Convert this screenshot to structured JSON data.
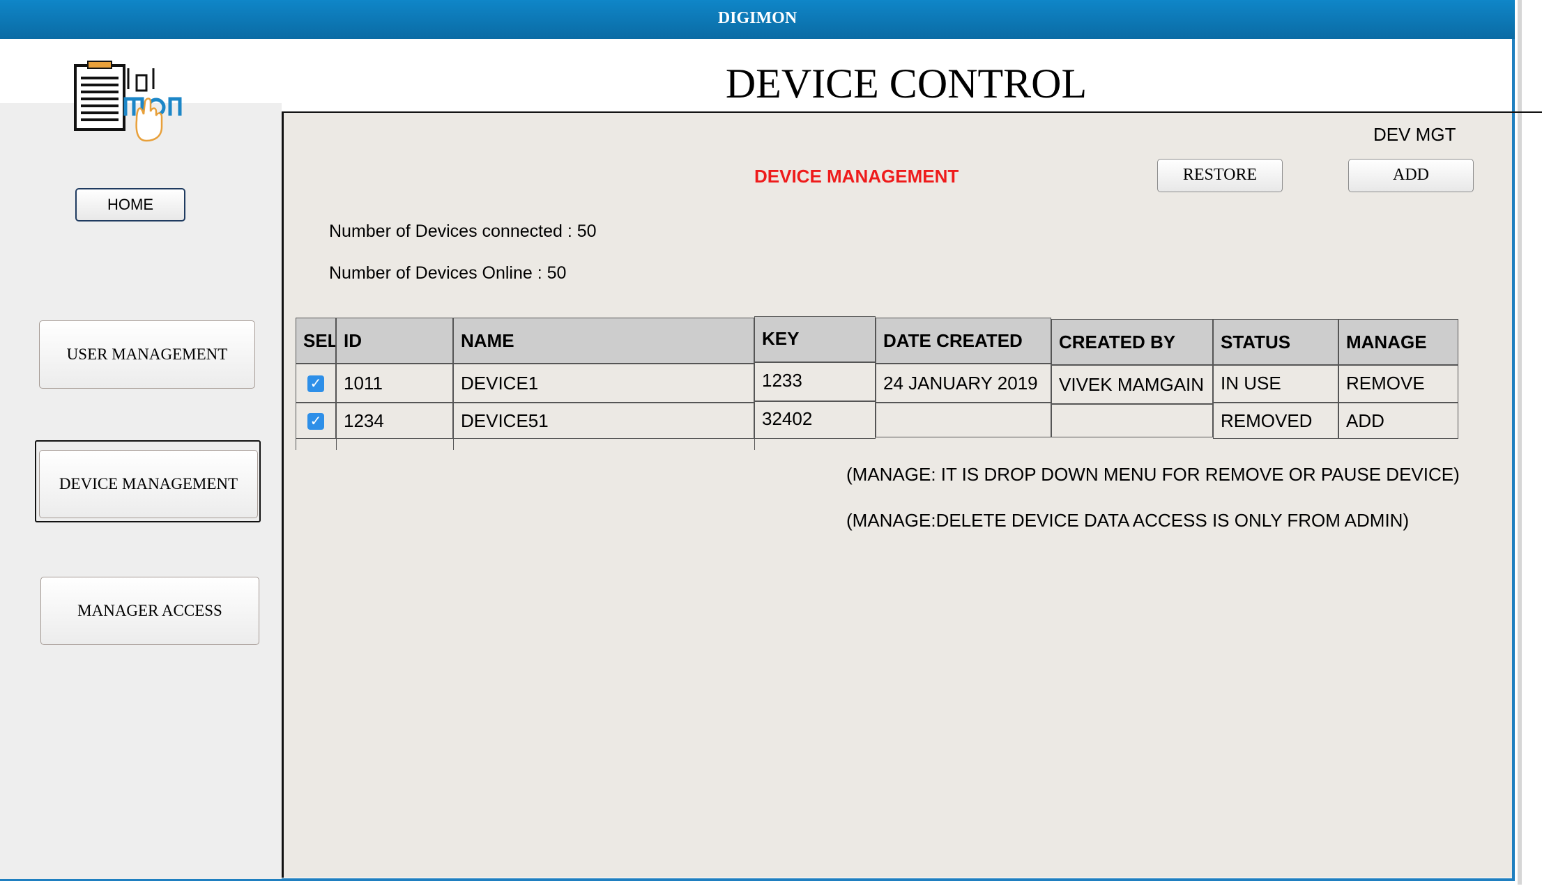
{
  "window": {
    "title": "DIGIMON"
  },
  "header": {
    "title": "DEVICE CONTROL"
  },
  "logo": {
    "text": "DIGIMON"
  },
  "sidebar": {
    "home_label": "HOME",
    "items": [
      {
        "label": "USER MANAGEMENT"
      },
      {
        "label": "DEVICE MANAGEMENT",
        "selected": true
      },
      {
        "label": "MANAGER ACCESS"
      }
    ]
  },
  "main": {
    "corner_label": "DEV MGT",
    "section_title": "DEVICE MANAGEMENT",
    "restore_label": "RESTORE",
    "add_label": "ADD",
    "devices_connected": "Number of Devices connected : 50",
    "devices_online": "Number of Devices Online : 50",
    "table": {
      "headers": [
        "SEL",
        "ID",
        "NAME",
        "KEY",
        "DATE CREATED",
        "CREATED BY",
        "STATUS",
        "MANAGE"
      ],
      "rows": [
        {
          "selected": true,
          "id": "1011",
          "name": "DEVICE1",
          "key": "1233",
          "date_created": "24 JANUARY 2019",
          "created_by": "VIVEK MAMGAIN",
          "status": "IN USE",
          "manage": "REMOVE"
        },
        {
          "selected": true,
          "id": "1234",
          "name": "DEVICE51",
          "key": "32402",
          "date_created": "",
          "created_by": "",
          "status": "REMOVED",
          "manage": "ADD"
        }
      ]
    },
    "notes": [
      "(MANAGE: IT IS DROP DOWN MENU FOR REMOVE OR PAUSE DEVICE)",
      "(MANAGE:DELETE DEVICE DATA ACCESS IS ONLY FROM ADMIN)"
    ]
  },
  "colors": {
    "title_bar": "#0b6ba4",
    "accent_red": "#ee1b1b",
    "checkbox": "#2e8fe8"
  }
}
